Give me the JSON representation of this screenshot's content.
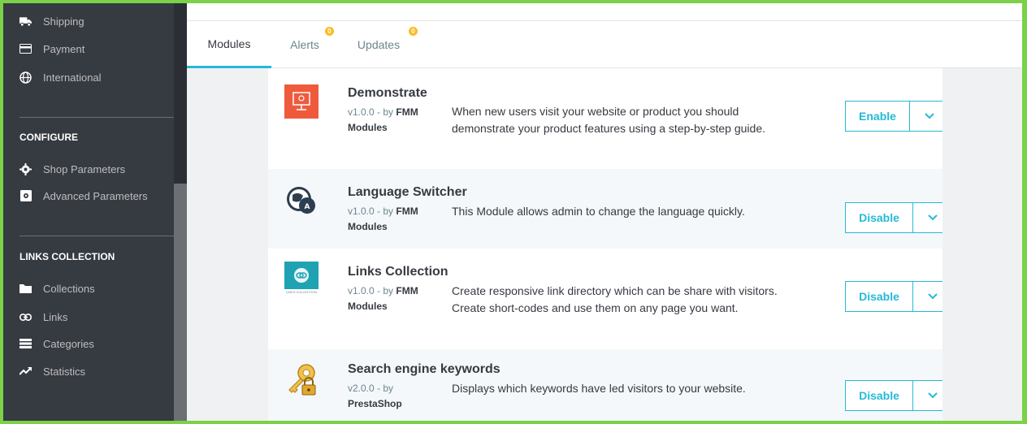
{
  "sidebar": {
    "items_top": [
      {
        "label": "Shipping",
        "icon": "truck-icon"
      },
      {
        "label": "Payment",
        "icon": "credit-card-icon"
      },
      {
        "label": "International",
        "icon": "globe-icon"
      }
    ],
    "configure": {
      "title": "CONFIGURE",
      "items": [
        {
          "label": "Shop Parameters",
          "icon": "gear-icon"
        },
        {
          "label": "Advanced Parameters",
          "icon": "settings-box-icon"
        }
      ]
    },
    "links_collection": {
      "title": "LINKS COLLECTION",
      "items": [
        {
          "label": "Collections",
          "icon": "folder-icon"
        },
        {
          "label": "Links",
          "icon": "link-icon"
        },
        {
          "label": "Categories",
          "icon": "list-icon"
        },
        {
          "label": "Statistics",
          "icon": "trending-icon"
        }
      ]
    }
  },
  "tabs": [
    {
      "label": "Modules",
      "active": true
    },
    {
      "label": "Alerts",
      "badge": "0"
    },
    {
      "label": "Updates",
      "badge": "0"
    }
  ],
  "modules": [
    {
      "name": "Demonstrate",
      "version": "v1.0.0 - by",
      "author_a": "FMM",
      "author_b": "Modules",
      "description": "When new users visit your website or product you should demonstrate your product features using a step-by-step guide.",
      "action": "Enable",
      "icon": "presentation-icon"
    },
    {
      "name": "Language Switcher",
      "version": "v1.0.0 - by",
      "author_a": "FMM",
      "author_b": "Modules",
      "description": "This Module allows admin to change the language quickly.",
      "action": "Disable",
      "icon": "language-icon"
    },
    {
      "name": "Links Collection",
      "version": "v1.0.0 - by",
      "author_a": "FMM",
      "author_b": "Modules",
      "description": "Create responsive link directory which can be share with visitors. Create short-codes and use them on any page you want.",
      "action": "Disable",
      "icon": "links-collection-icon",
      "icon_caption": "LINKS COLLECTION"
    },
    {
      "name": "Search engine keywords",
      "version": "v2.0.0 - by",
      "author_a": "",
      "author_b": "PrestaShop",
      "description": "Displays which keywords have led visitors to your website.",
      "action": "Disable",
      "icon": "key-lock-icon"
    }
  ],
  "colors": {
    "frame": "#7bd148",
    "sidebar": "#363a41",
    "accent": "#25b9d7",
    "badge": "#fbbb22",
    "demonstrate_icon": "#ef5a3d",
    "links_icon": "#1fa3b3"
  }
}
